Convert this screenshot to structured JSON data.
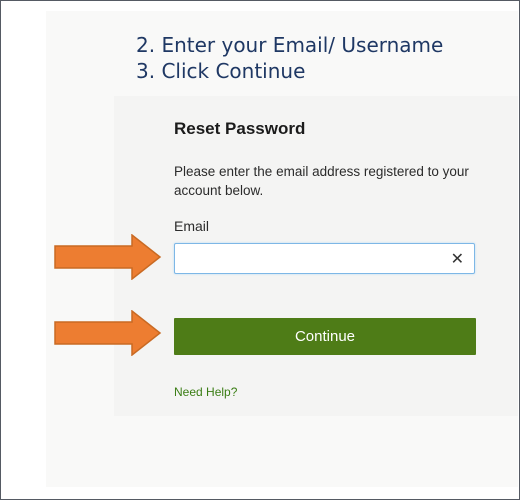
{
  "instructions": {
    "step2": "2. Enter your Email/ Username",
    "step3": "3. Click Continue"
  },
  "reset_form": {
    "title": "Reset Password",
    "description": "Please enter the email address registered to your account below.",
    "email_label": "Email",
    "email_value": "",
    "clear_symbol": "✕",
    "continue_label": "Continue",
    "help_link": "Need Help?"
  },
  "annotations": {
    "arrow_color": "#ed7d31",
    "arrow_border_color": "#c96a23"
  },
  "colors": {
    "button_green": "#4e7c17",
    "link_green": "#3a7d14",
    "field_focus_border": "#7db7e6",
    "instruction_text": "#1f3864"
  }
}
